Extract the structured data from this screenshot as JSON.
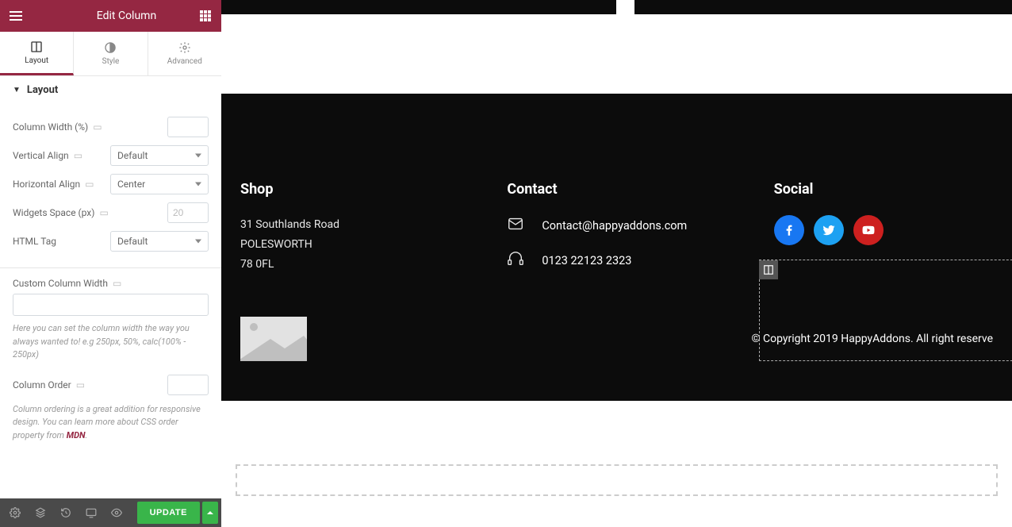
{
  "panel": {
    "title": "Edit Column",
    "tabs": {
      "layout": "Layout",
      "style": "Style",
      "advanced": "Advanced"
    },
    "section_layout": "Layout",
    "column_width_label": "Column Width (%)",
    "vertical_align_label": "Vertical Align",
    "vertical_align_value": "Default",
    "horizontal_align_label": "Horizontal Align",
    "horizontal_align_value": "Center",
    "widgets_space_label": "Widgets Space (px)",
    "widgets_space_placeholder": "20",
    "html_tag_label": "HTML Tag",
    "html_tag_value": "Default",
    "custom_col_width_label": "Custom Column Width",
    "custom_col_width_hint": "Here you can set the column width the way you always wanted to! e.g 250px, 50%, calc(100% - 250px)",
    "column_order_label": "Column Order",
    "column_order_hint_pre": "Column ordering is a great addition for responsive design. You can learn more about CSS order property from ",
    "column_order_hint_link": "MDN",
    "update_button": "UPDATE"
  },
  "footer": {
    "shop": {
      "heading": "Shop",
      "line1": "31 Southlands Road",
      "line2": "POLESWORTH",
      "line3": "78 0FL"
    },
    "contact": {
      "heading": "Contact",
      "email": "Contact@happyaddons.com",
      "phone": "0123 22123 2323"
    },
    "social": {
      "heading": "Social"
    },
    "copyright": "© Copyright 2019 HappyAddons. All right reserve"
  }
}
